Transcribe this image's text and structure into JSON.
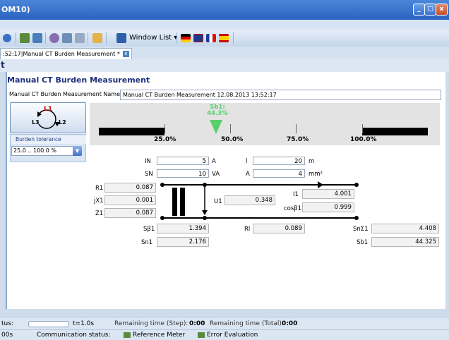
{
  "window": {
    "title": "OM10)",
    "min": "_",
    "max": "□",
    "close": "x"
  },
  "toolbar": {
    "window_list": "Window List"
  },
  "tab": {
    "label": ":52:17|Manual CT Burden Measurement *",
    "close": "x"
  },
  "strip": {
    "text": "t"
  },
  "panel": {
    "title": "Manual CT Burden Measurement",
    "name_label": "Manual CT Burden Measurement Name:",
    "name_value": "Manual CT Burden Measurement 12.08.2013 13:52:17"
  },
  "ct_icon": {
    "l1": "L1",
    "l2": "L2",
    "l3": "L3"
  },
  "tolerance": {
    "label": "Burden tolerance",
    "value": "25.0 .. 100.0 %"
  },
  "gauge": {
    "pointer_label": "Sb1:",
    "pointer_value": "44.3%",
    "pointer_fraction": 0.443,
    "ticks": [
      "25.0%",
      "50.0%",
      "75.0%",
      "100.0%"
    ]
  },
  "inputs": {
    "in_label": "IN",
    "in_value": "5",
    "in_unit": "A",
    "l_label": "l",
    "l_value": "20",
    "l_unit": "m",
    "sn_label": "SN",
    "sn_value": "10",
    "sn_unit": "VA",
    "a_label": "A",
    "a_value": "4",
    "a_unit": "mm²"
  },
  "results": {
    "r1_label": "R1",
    "r1_value": "0.087",
    "x1_label": "jX1",
    "x1_value": "0.001",
    "z1_label": "Z1",
    "z1_value": "0.087",
    "u1_label": "U1",
    "u1_value": "0.348",
    "i1_label": "I1",
    "i1_value": "4.001",
    "cos_label": "cosβ1",
    "cos_value": "0.999",
    "sb_label": "Sβ1",
    "sb_value": "1.394",
    "rl_label": "Rl",
    "rl_value": "0.089",
    "snsum_label": "SnΣ1",
    "snsum_value": "4.408",
    "sn1_label": "Sn1",
    "sn1_value": "2.176",
    "sb1_label": "Sb1",
    "sb1_value": "44.325"
  },
  "status": {
    "label": "tus:",
    "time": "t=1.0s",
    "step_label": "Remaining time (Step):",
    "step_value": "0:00",
    "total_label": "Remaining time (Total):",
    "total_value": "0:00",
    "row2_time": "00s",
    "comm_label": "Communication status:",
    "ref_meter": "Reference Meter",
    "err_eval": "Error Evaluation"
  }
}
